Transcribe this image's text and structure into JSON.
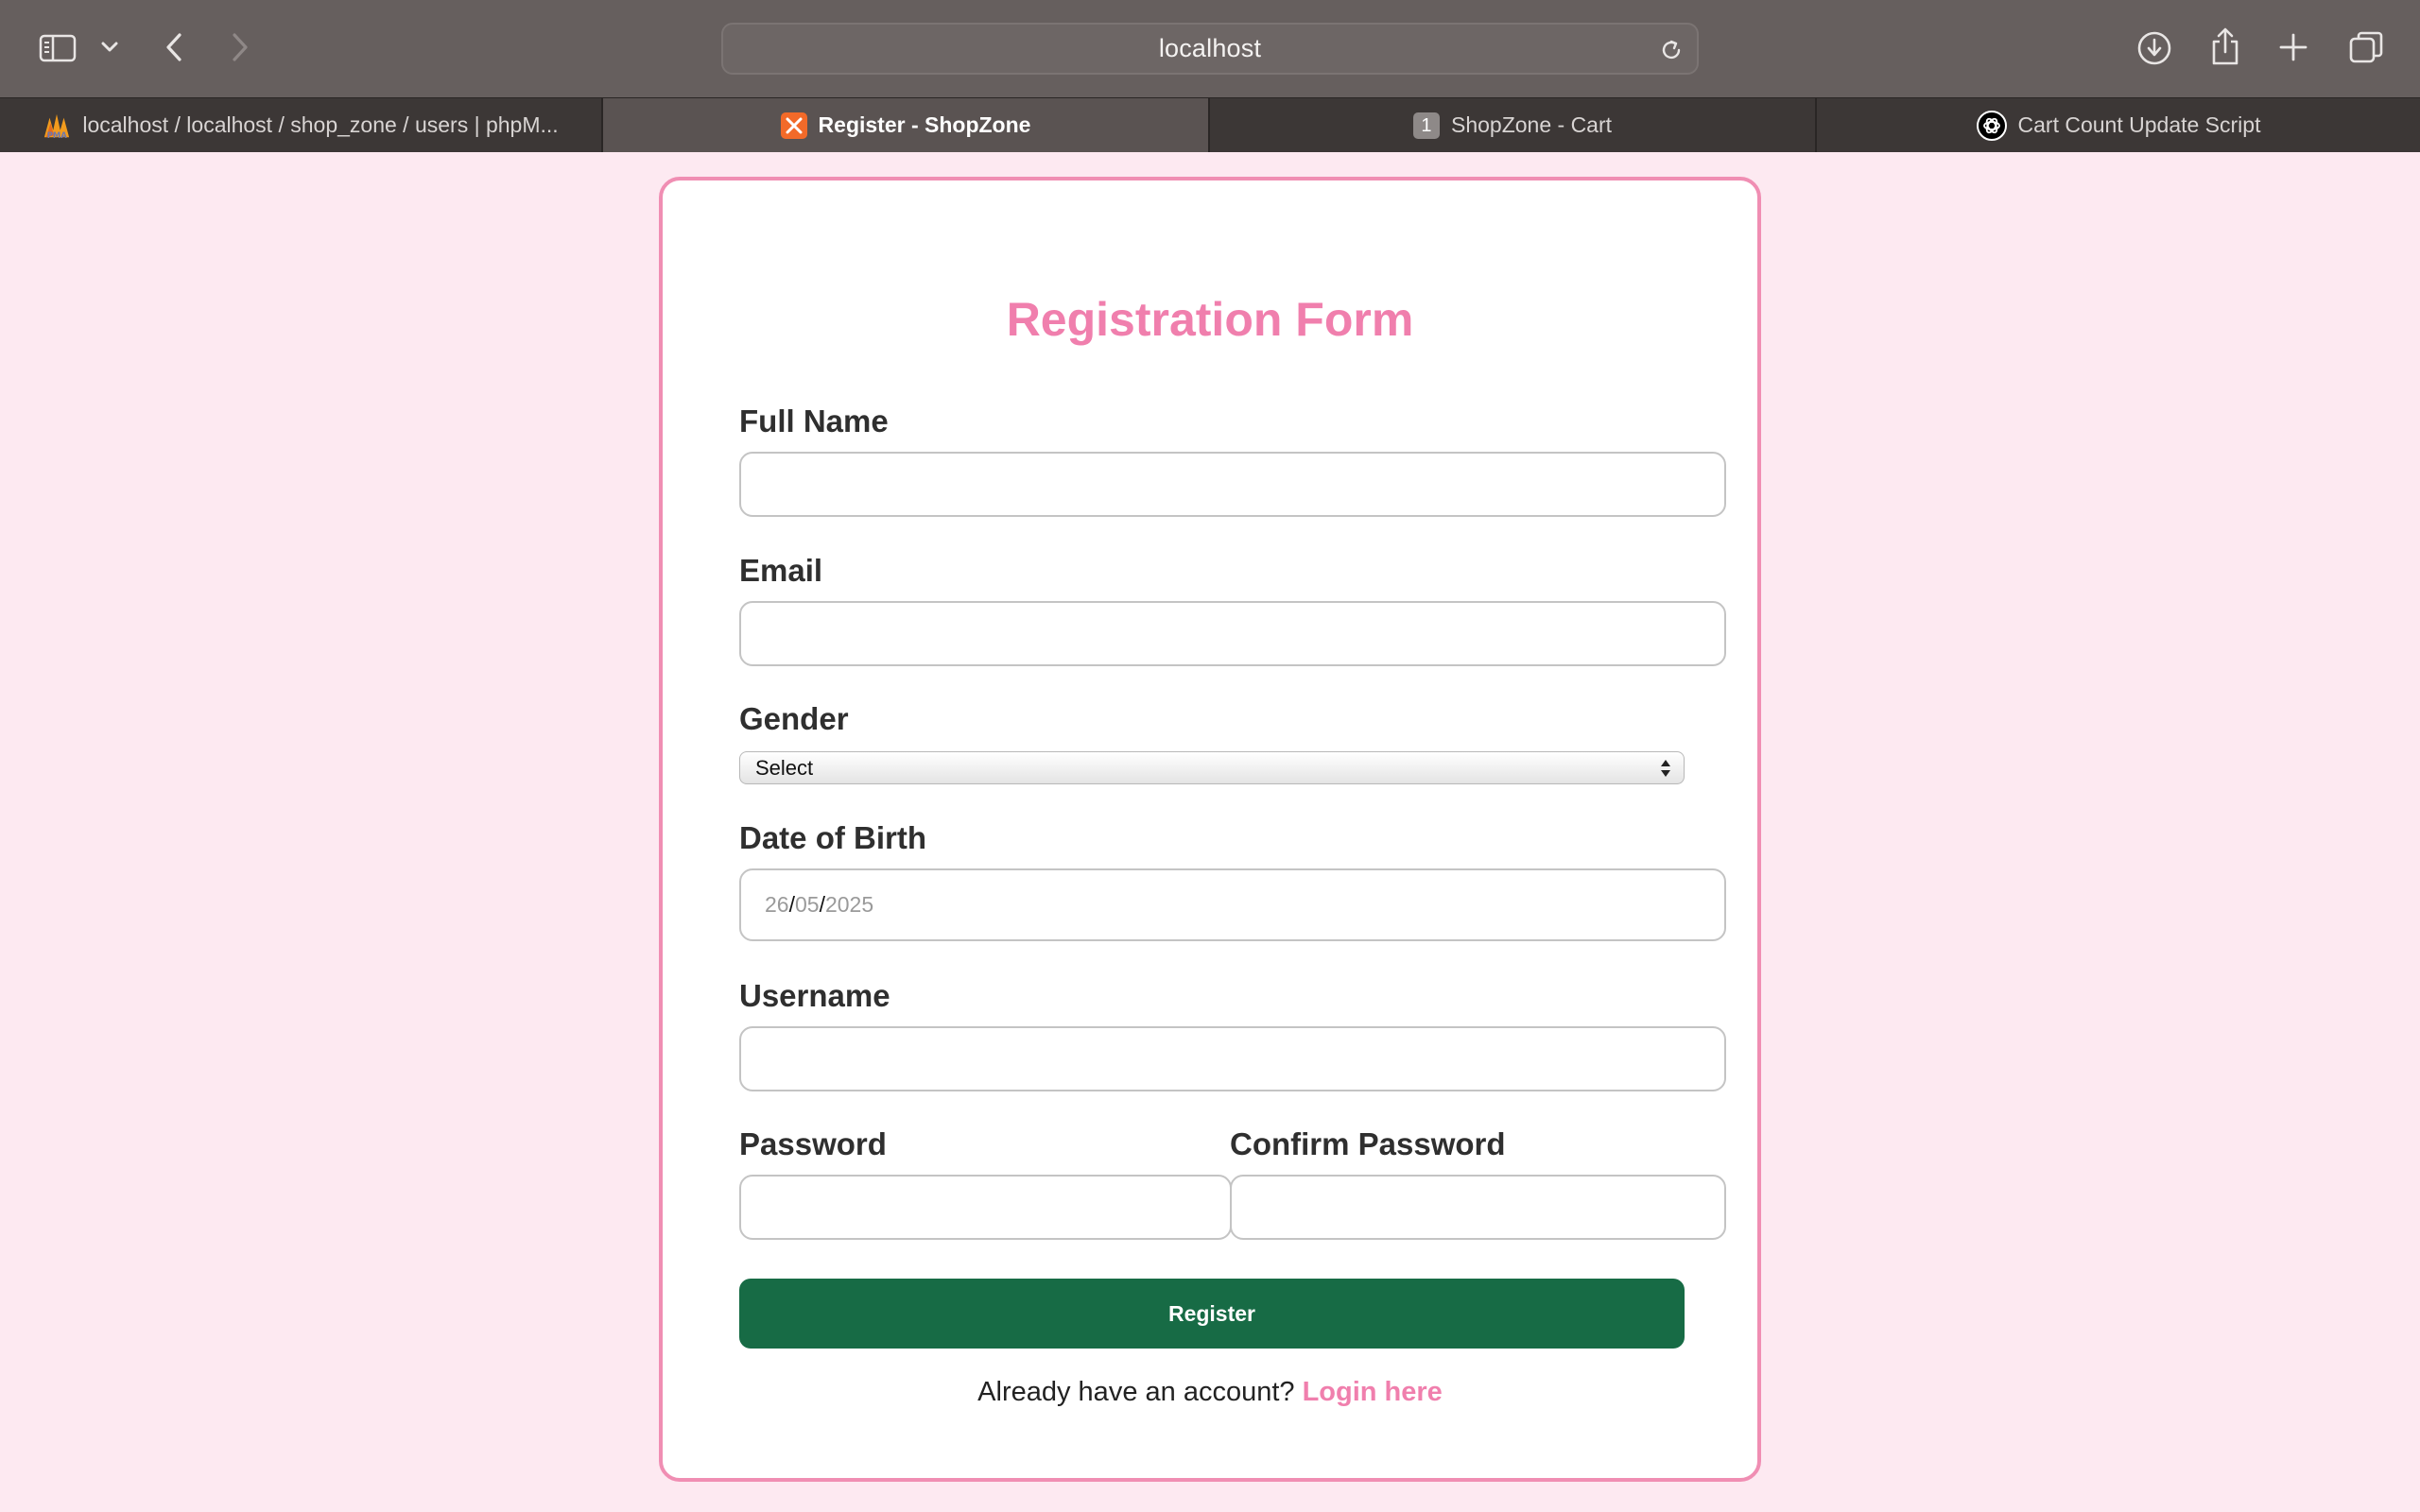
{
  "browser": {
    "address": "localhost",
    "tabs": [
      {
        "label": "localhost / localhost / shop_zone / users | phpM...",
        "icon": "phpmyadmin-icon",
        "active": false
      },
      {
        "label": "Register - ShopZone",
        "icon": "xampp-icon",
        "active": true
      },
      {
        "label": "ShopZone - Cart",
        "icon": "tab-number-icon",
        "badge": "1",
        "active": false
      },
      {
        "label": "Cart Count Update Script",
        "icon": "chatgpt-icon",
        "active": false
      }
    ]
  },
  "form": {
    "title": "Registration Form",
    "full_name_label": "Full Name",
    "email_label": "Email",
    "gender_label": "Gender",
    "gender_selected": "Select",
    "dob_label": "Date of Birth",
    "dob_day": "26",
    "dob_month": "05",
    "dob_year": "2025",
    "dob_separator": "/",
    "username_label": "Username",
    "password_label": "Password",
    "confirm_password_label": "Confirm Password",
    "register_label": "Register",
    "login_prompt": "Already have an account?",
    "login_link": "Login here"
  },
  "colors": {
    "page_bg": "#fde9f1",
    "accent_pink": "#f07fad",
    "button_green": "#176b45"
  }
}
